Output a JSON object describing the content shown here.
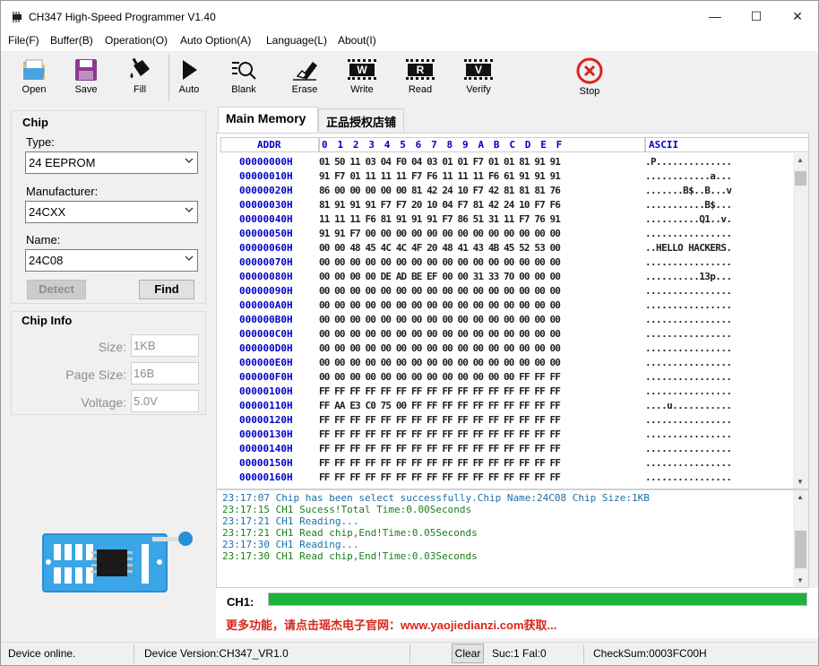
{
  "window": {
    "title": "CH347 High-Speed Programmer  V1.40",
    "minimize": "—",
    "maximize": "☐",
    "close": "✕"
  },
  "menu": [
    "File(F)",
    "Buffer(B)",
    "Operation(O)",
    "Auto Option(A)",
    "Language(L)",
    "About(I)"
  ],
  "toolbar": {
    "open": "Open",
    "save": "Save",
    "fill": "Fill",
    "auto": "Auto",
    "blank": "Blank",
    "erase": "Erase",
    "write": "Write",
    "read": "Read",
    "verify": "Verify",
    "stop": "Stop",
    "write_glyph": "W",
    "read_glyph": "R",
    "verify_glyph": "V"
  },
  "chip": {
    "title": "Chip",
    "type_label": "Type:",
    "type_value": "24 EEPROM",
    "manufacturer_label": "Manufacturer:",
    "manufacturer_value": "24CXX",
    "name_label": "Name:",
    "name_value": "24C08",
    "detect": "Detect",
    "find": "Find"
  },
  "chip_info": {
    "title": "Chip Info",
    "size_label": "Size:",
    "size_value": "1KB",
    "page_label": "Page Size:",
    "page_value": "16B",
    "voltage_label": "Voltage:",
    "voltage_value": "5.0V"
  },
  "tabs": [
    "Main Memory",
    "正品授权店铺"
  ],
  "hex": {
    "addr_header": "ADDR",
    "col_header": "0 1 2 3 4 5 6 7 8 9 A B C D E F",
    "ascii_header": "ASCII",
    "rows": [
      {
        "addr": "00000000H",
        "bytes": "01 50 11 03 04 F0 04 03 01 01 F7 01 01 81 91 91",
        "ascii": ".P.............."
      },
      {
        "addr": "00000010H",
        "bytes": "91 F7 01 11 11 11 F7 F6 11 11 11 F6 61 91 91 91",
        "ascii": "............a..."
      },
      {
        "addr": "00000020H",
        "bytes": "86 00 00 00 00 00 81 42 24 10 F7 42 81 81 81 76",
        "ascii": ".......B$..B...v"
      },
      {
        "addr": "00000030H",
        "bytes": "81 91 91 91 F7 F7 20 10 04 F7 81 42 24 10 F7 F6",
        "ascii": "...........B$..."
      },
      {
        "addr": "00000040H",
        "bytes": "11 11 11 F6 81 91 91 91 F7 86 51 31 11 F7 76 91",
        "ascii": "..........Q1..v."
      },
      {
        "addr": "00000050H",
        "bytes": "91 91 F7 00 00 00 00 00 00 00 00 00 00 00 00 00",
        "ascii": "................"
      },
      {
        "addr": "00000060H",
        "bytes": "00 00 48 45 4C 4C 4F 20 48 41 43 4B 45 52 53 00",
        "ascii": "..HELLO HACKERS."
      },
      {
        "addr": "00000070H",
        "bytes": "00 00 00 00 00 00 00 00 00 00 00 00 00 00 00 00",
        "ascii": "................"
      },
      {
        "addr": "00000080H",
        "bytes": "00 00 00 00 DE AD BE EF 00 00 31 33 70 00 00 00",
        "ascii": "..........13p..."
      },
      {
        "addr": "00000090H",
        "bytes": "00 00 00 00 00 00 00 00 00 00 00 00 00 00 00 00",
        "ascii": "................"
      },
      {
        "addr": "000000A0H",
        "bytes": "00 00 00 00 00 00 00 00 00 00 00 00 00 00 00 00",
        "ascii": "................"
      },
      {
        "addr": "000000B0H",
        "bytes": "00 00 00 00 00 00 00 00 00 00 00 00 00 00 00 00",
        "ascii": "................"
      },
      {
        "addr": "000000C0H",
        "bytes": "00 00 00 00 00 00 00 00 00 00 00 00 00 00 00 00",
        "ascii": "................"
      },
      {
        "addr": "000000D0H",
        "bytes": "00 00 00 00 00 00 00 00 00 00 00 00 00 00 00 00",
        "ascii": "................"
      },
      {
        "addr": "000000E0H",
        "bytes": "00 00 00 00 00 00 00 00 00 00 00 00 00 00 00 00",
        "ascii": "................"
      },
      {
        "addr": "000000F0H",
        "bytes": "00 00 00 00 00 00 00 00 00 00 00 00 00 FF FF FF",
        "ascii": "................"
      },
      {
        "addr": "00000100H",
        "bytes": "FF FF FF FF FF FF FF FF FF FF FF FF FF FF FF FF",
        "ascii": "................"
      },
      {
        "addr": "00000110H",
        "bytes": "FF AA E3 C0 75 00 FF FF FF FF FF FF FF FF FF FF",
        "ascii": "....u..........."
      },
      {
        "addr": "00000120H",
        "bytes": "FF FF FF FF FF FF FF FF FF FF FF FF FF FF FF FF",
        "ascii": "................"
      },
      {
        "addr": "00000130H",
        "bytes": "FF FF FF FF FF FF FF FF FF FF FF FF FF FF FF FF",
        "ascii": "................"
      },
      {
        "addr": "00000140H",
        "bytes": "FF FF FF FF FF FF FF FF FF FF FF FF FF FF FF FF",
        "ascii": "................"
      },
      {
        "addr": "00000150H",
        "bytes": "FF FF FF FF FF FF FF FF FF FF FF FF FF FF FF FF",
        "ascii": "................"
      },
      {
        "addr": "00000160H",
        "bytes": "FF FF FF FF FF FF FF FF FF FF FF FF FF FF FF FF",
        "ascii": "................"
      }
    ]
  },
  "log": [
    {
      "text": "23:17:07 Chip has been select successfully.Chip Name:24C08 Chip Size:1KB",
      "color": "#1a6fa8"
    },
    {
      "text": "23:17:15 CH1 Sucess!Total Time:0.00Seconds",
      "color": "#1a7f1a"
    },
    {
      "text": "23:17:21 CH1 Reading...",
      "color": "#1a6fa8"
    },
    {
      "text": "23:17:21 CH1 Read chip,End!Time:0.05Seconds",
      "color": "#1a7f1a"
    },
    {
      "text": "23:17:30 CH1 Reading...",
      "color": "#1a6fa8"
    },
    {
      "text": "23:17:30 CH1 Read chip,End!Time:0.03Seconds",
      "color": "#1a7f1a"
    }
  ],
  "progress": {
    "label": "CH1:",
    "value": 1.0,
    "color": "#1db33a"
  },
  "promo": "更多功能，请点击瑶杰电子官网：www.yaojiedianzi.com获取...",
  "status": {
    "device": "Device online.",
    "version": "Device Version:CH347_VR1.0",
    "clear": "Clear",
    "suc": "Suc:1",
    "fal": "Fal:0",
    "checksum": "CheckSum:0003FC00H"
  }
}
